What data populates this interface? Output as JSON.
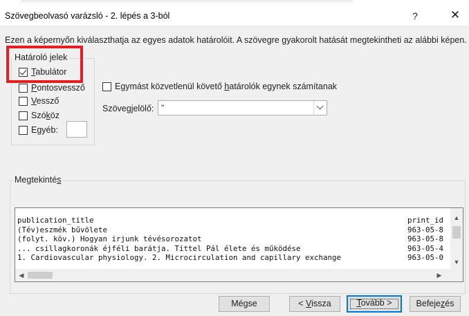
{
  "window": {
    "title": "Szövegbeolvasó varázsló - 2. lépés a 3-ból",
    "help_label": "?",
    "close_label": "✕",
    "help_icon": "question-mark",
    "close_icon": "close-x"
  },
  "description": "Ezen a képernyőn kiválaszthatja az egyes adatok határolóit. A szövegre gyakorolt hatását megtekintheti az alábbi képen.",
  "delimiters": {
    "group_label": "Határoló jelek",
    "options": [
      {
        "pre": "",
        "key": "T",
        "post": "abulátor",
        "checked": true
      },
      {
        "pre": "",
        "key": "P",
        "post": "ontosvessző",
        "checked": false
      },
      {
        "pre": "",
        "key": "V",
        "post": "essző",
        "checked": false
      },
      {
        "pre": "Szó",
        "key": "k",
        "post": "öz",
        "checked": false
      },
      {
        "pre": "E",
        "key": "g",
        "post": "yéb:",
        "checked": false
      }
    ],
    "other_value": ""
  },
  "consecutive": {
    "pre": "Egymást közvetlenül követő ",
    "key": "h",
    "post": "atárolók egynek számítanak",
    "checked": false
  },
  "qualifier": {
    "pre": "Szöveg",
    "key": "j",
    "post": "elölő:",
    "value": "\""
  },
  "preview": {
    "group_pre": "Megtekinté",
    "group_key": "s",
    "group_post": "",
    "lines": [
      "publication_title",
      "(Tév)eszmék bűvölete",
      "(folyt. köv.) Hogyan irjunk tévésorozatot",
      "... csillagkoronák éjféli barátja. Tittel Pál élete és működése",
      "1. Cardiovascular physiology. 2. Microcirculation and capillary exchange"
    ],
    "col2": [
      "print_id",
      "963-05-8",
      "963-05-8",
      "963-05-4",
      "963-05-0"
    ],
    "scroll_up": "▲",
    "scroll_down": "▼",
    "scroll_left": "◀",
    "scroll_right": "▶"
  },
  "buttons": {
    "cancel": {
      "pre": "Mégse",
      "key": "",
      "post": ""
    },
    "back": {
      "pre": "< ",
      "key": "V",
      "post": "issza"
    },
    "next": {
      "pre": "",
      "key": "T",
      "post": "ovább >"
    },
    "finish": {
      "pre": "Befeje",
      "key": "z",
      "post": "és"
    }
  },
  "colors": {
    "highlight": "#e31e24",
    "default_button_border": "#0078d7",
    "dialog_bg": "#f0f0f0"
  }
}
